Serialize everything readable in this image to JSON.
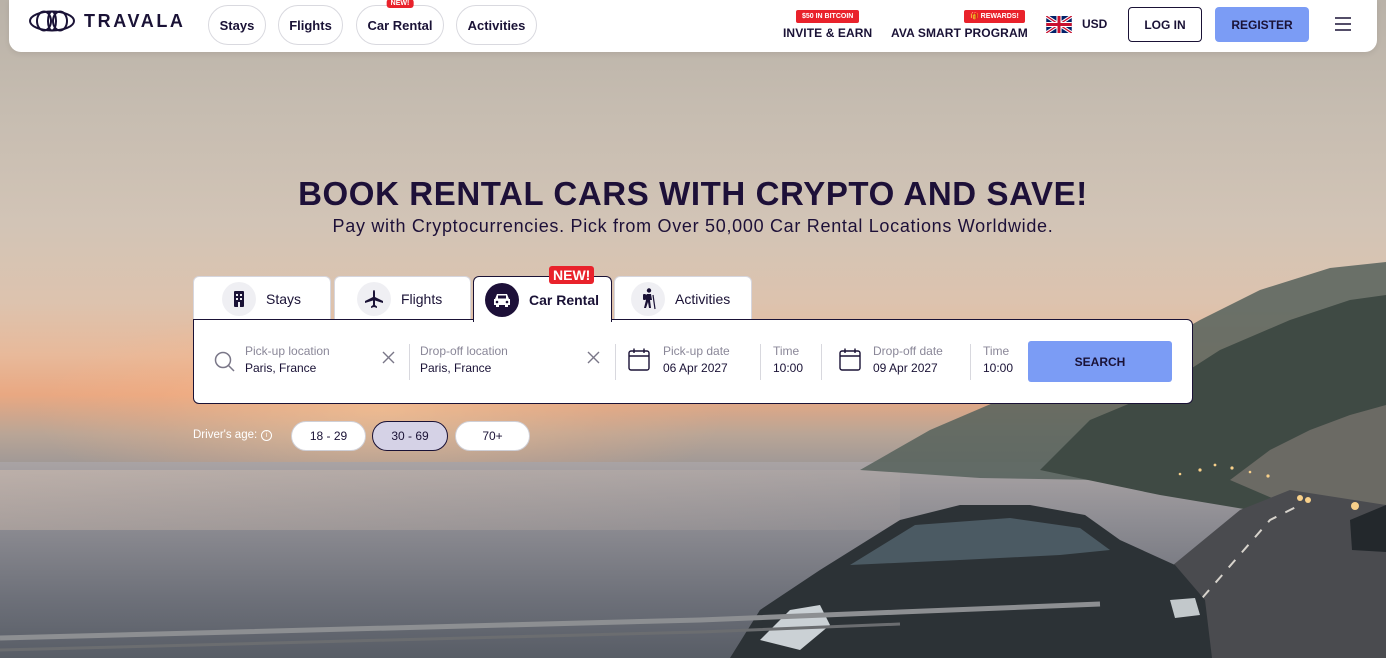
{
  "brand": {
    "name": "TRAVALA"
  },
  "nav": {
    "tabs": [
      {
        "label": "Stays"
      },
      {
        "label": "Flights"
      },
      {
        "label": "Car Rental",
        "badge": "NEW!"
      },
      {
        "label": "Activities"
      }
    ],
    "invite": {
      "badge": "$50 IN BITCOIN",
      "label": "INVITE & EARN"
    },
    "smart": {
      "badge": "🎁 REWARDS!",
      "label": "AVA SMART PROGRAM"
    },
    "currency": "USD",
    "flag_icon": "uk-flag-icon",
    "login_label": "LOG IN",
    "register_label": "REGISTER",
    "menu_icon": "hamburger-menu-icon"
  },
  "hero": {
    "title": "BOOK RENTAL CARS WITH CRYPTO AND SAVE!",
    "subtitle": "Pay with Cryptocurrencies. Pick from Over 50,000 Car Rental Locations Worldwide."
  },
  "search_tabs": [
    {
      "label": "Stays",
      "icon": "building-icon"
    },
    {
      "label": "Flights",
      "icon": "airplane-icon"
    },
    {
      "label": "Car Rental",
      "icon": "car-icon",
      "badge": "NEW!",
      "active": true
    },
    {
      "label": "Activities",
      "icon": "hiker-icon"
    }
  ],
  "search": {
    "pickup_location": {
      "label": "Pick-up location",
      "value": "Paris, France"
    },
    "dropoff_location": {
      "label": "Drop-off location",
      "value": "Paris, France"
    },
    "pickup_date": {
      "label": "Pick-up date",
      "value": "06 Apr 2027"
    },
    "pickup_time": {
      "label": "Time",
      "value": "10:00"
    },
    "dropoff_date": {
      "label": "Drop-off date",
      "value": "09 Apr 2027"
    },
    "dropoff_time": {
      "label": "Time",
      "value": "10:00"
    },
    "button_label": "SEARCH"
  },
  "driver_age": {
    "label": "Driver's age:",
    "options": [
      "18 - 29",
      "30 - 69",
      "70+"
    ],
    "selected": "30 - 69"
  },
  "colors": {
    "primary_dark": "#1a1236",
    "accent_blue": "#7b9cf5",
    "badge_red": "#e9222b"
  }
}
